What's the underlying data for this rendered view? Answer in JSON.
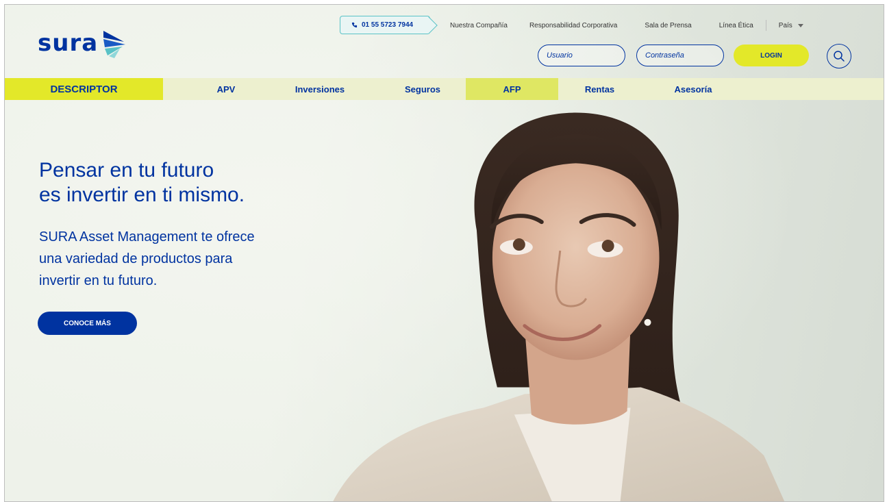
{
  "brand": {
    "logo_text": "sura"
  },
  "header": {
    "phone": "01 55 5723 7944",
    "links": [
      "Nuestra Compañía",
      "Responsabilidad Corporativa",
      "Sala de Prensa",
      "Línea Ética"
    ],
    "country_label": "País",
    "username_placeholder": "Usuario",
    "password_placeholder": "Contraseña",
    "login_label": "LOGIN"
  },
  "nav": {
    "items": [
      "DESCRIPTOR",
      "APV",
      "Inversiones",
      "Seguros",
      "AFP",
      "Rentas",
      "Asesoría"
    ]
  },
  "hero": {
    "headline_line1": "Pensar en tu futuro",
    "headline_line2": "es invertir en ti mismo.",
    "sub_line1": "SURA Asset Management te ofrece",
    "sub_line2": "una variedad de productos para",
    "sub_line3": "invertir en tu futuro.",
    "cta_label": "CONOCE MÁS"
  },
  "colors": {
    "brand_blue": "#0033a0",
    "accent_yellow": "#e3e829",
    "nav_bg": "#edf0cf",
    "teal": "#59c2c6"
  }
}
